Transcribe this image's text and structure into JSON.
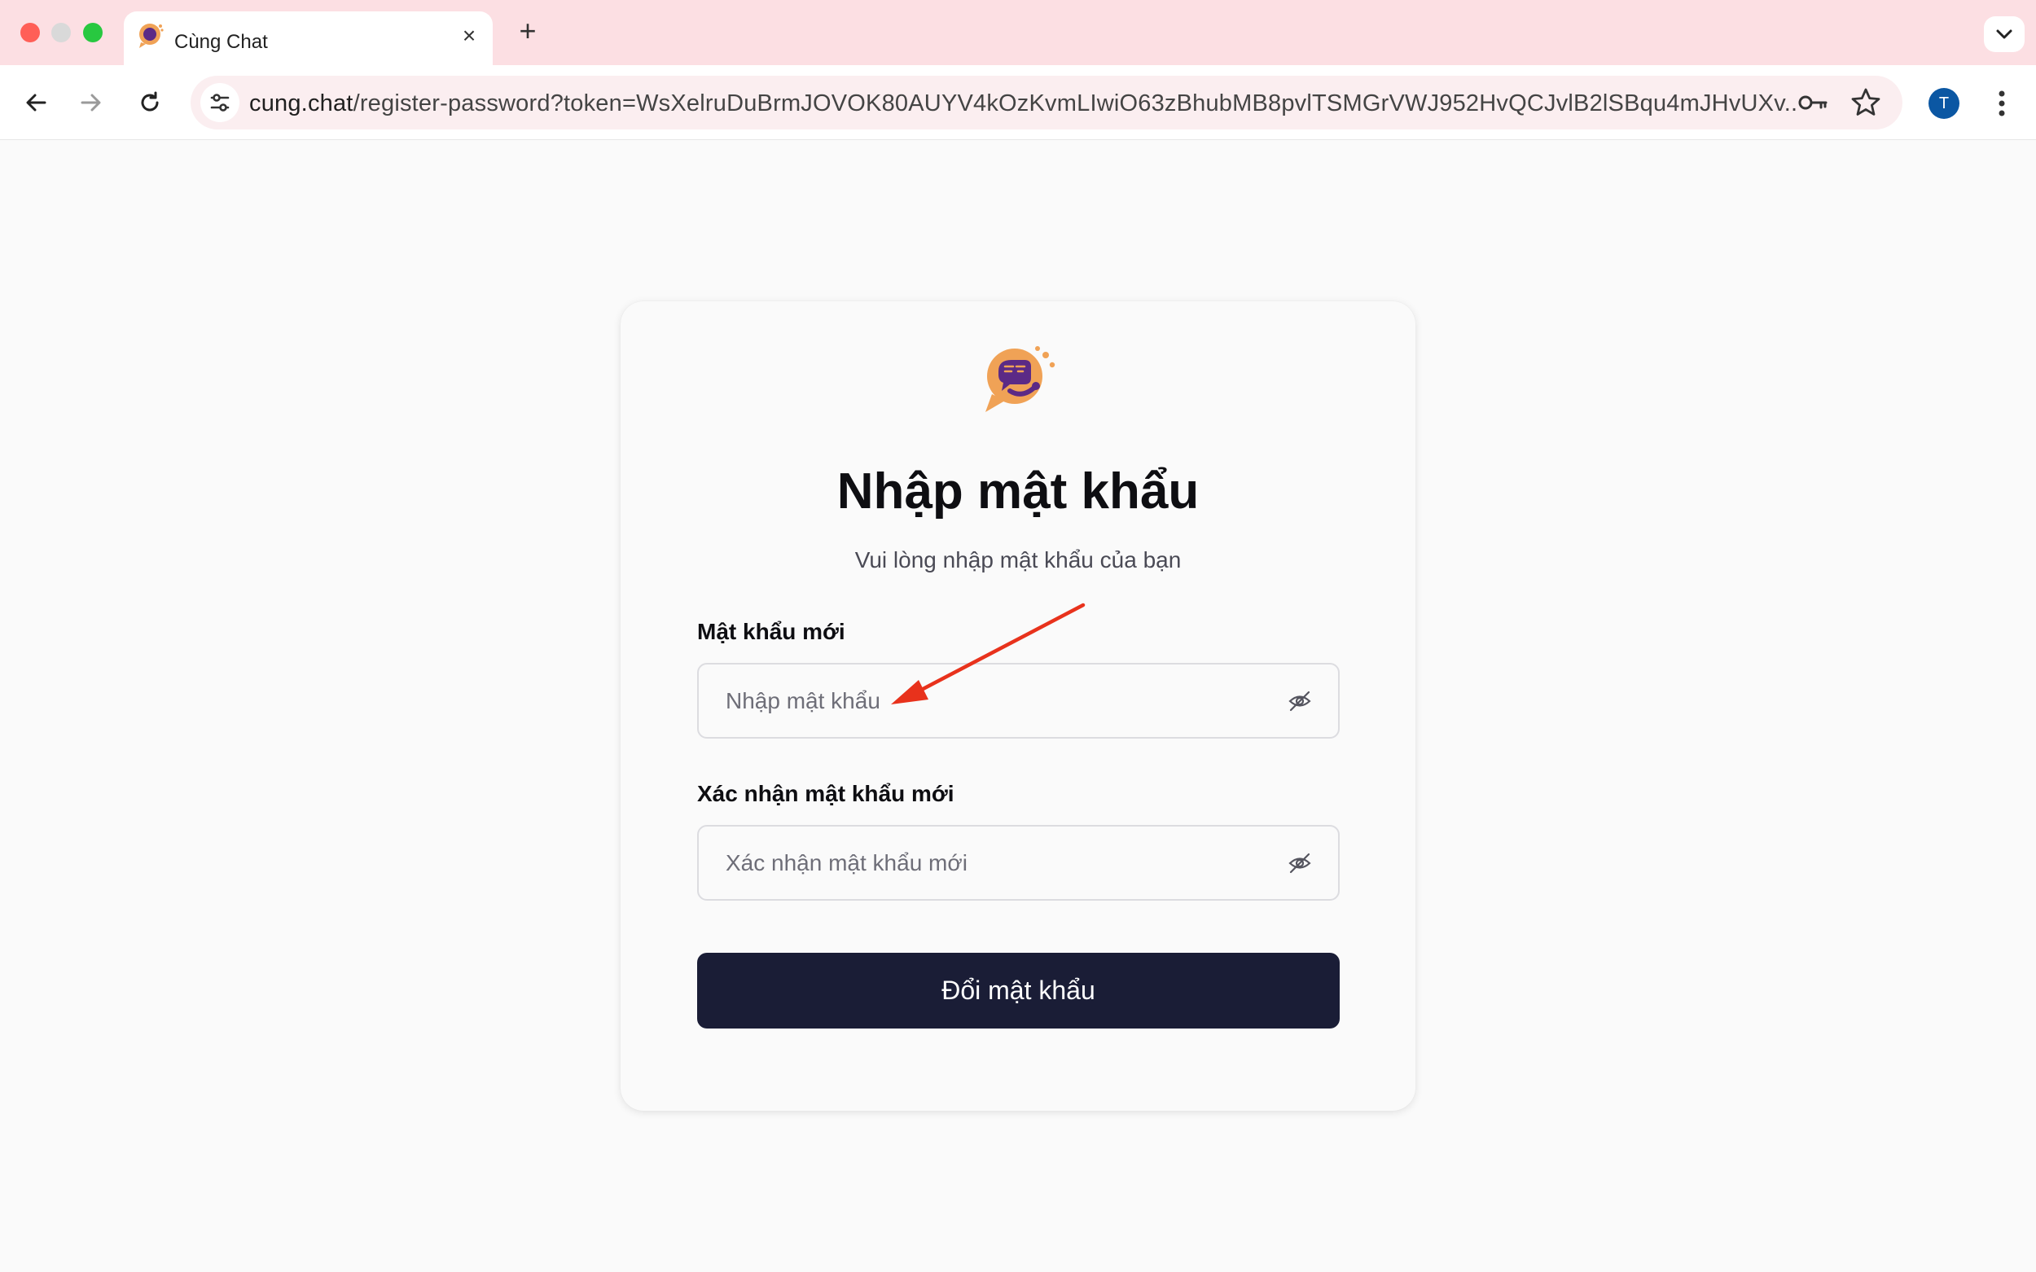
{
  "browser": {
    "tab": {
      "title": "Cùng Chat"
    },
    "address_bar": {
      "host": "cung.chat",
      "path": "/register-password?token=WsXelruDuBrmJOVOK80AUYV4kOzKvmLIwiO63zBhubMB8pvlTSMGrVWJ952HvQCJvlB2lSBqu4mJHvUXv..."
    },
    "profile": {
      "initial": "T"
    },
    "accent_color": "#fcdfe3"
  },
  "form": {
    "title": "Nhập mật khẩu",
    "subtitle": "Vui lòng nhập mật khẩu của bạn",
    "new_password": {
      "label": "Mật khẩu mới",
      "value": "",
      "placeholder": "Nhập mật khẩu"
    },
    "confirm_password": {
      "label": "Xác nhận mật khẩu mới",
      "value": "",
      "placeholder": "Xác nhận mật khẩu mới"
    },
    "submit_label": "Đổi mật khẩu",
    "button_color": "#1a1d36"
  },
  "annotation": {
    "arrow_color": "#e8321c",
    "points_to": "new-password-input"
  }
}
